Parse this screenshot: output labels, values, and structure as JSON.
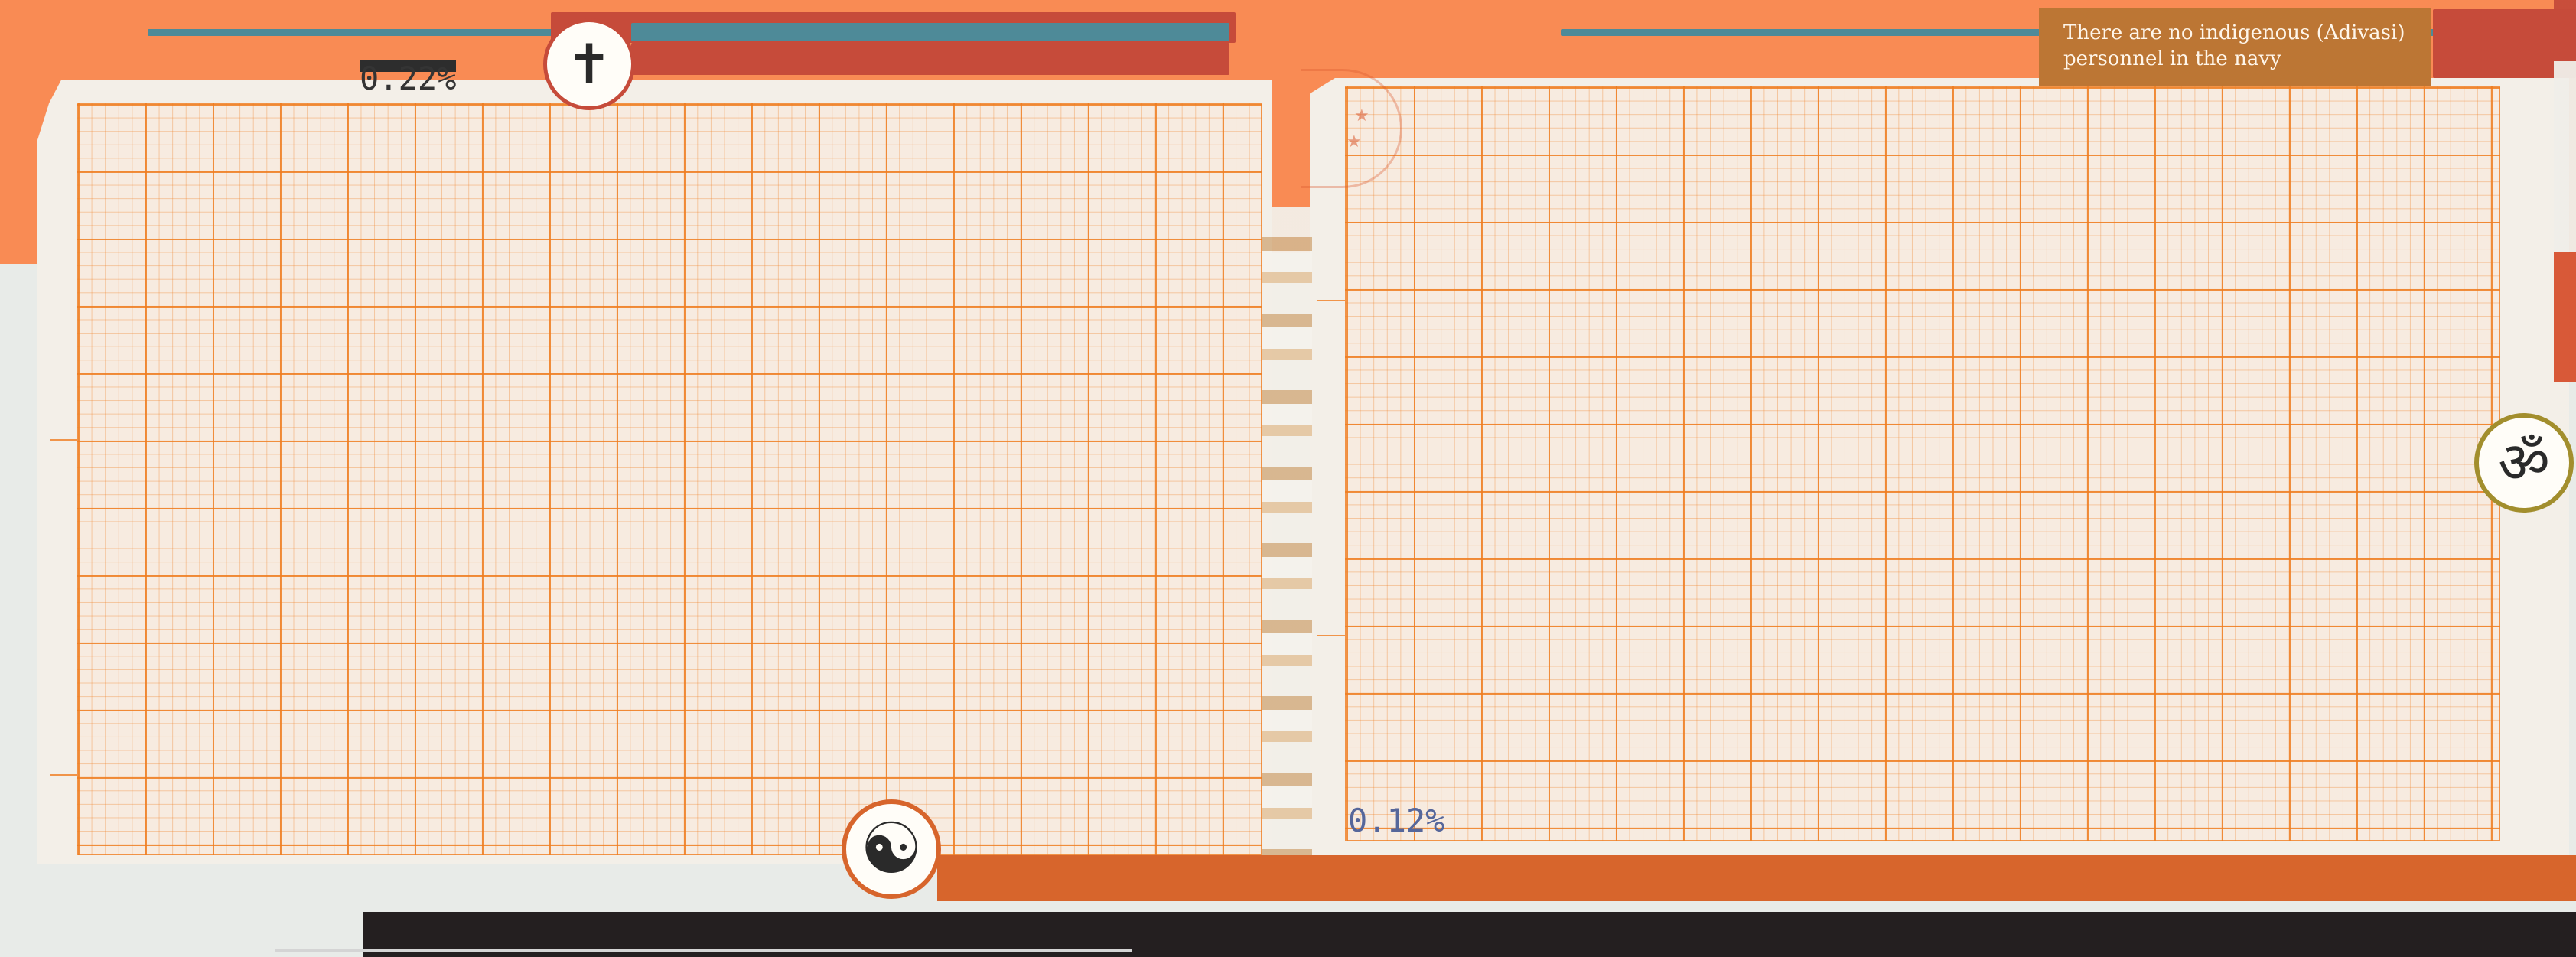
{
  "annotations": {
    "left_value": "0.22%",
    "right_value": "0.12%",
    "note": "There are no indigenous (Adivasi) personnel in the navy"
  },
  "icons": {
    "top": "cross-icon",
    "bottom": "yin-yang-icon",
    "right": "om-icon"
  },
  "colors": {
    "orange": "#f98b54",
    "red": "#c64b3a",
    "teal": "#4e8a98",
    "grid": "#ef7d20",
    "note_bg": "#bc7634",
    "right_label": "#56679b"
  }
}
